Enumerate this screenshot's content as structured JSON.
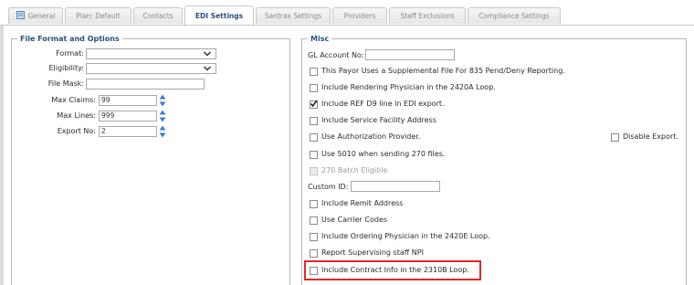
{
  "tabs": [
    {
      "label": "General",
      "icon": "document-icon"
    },
    {
      "label": "Plan: Default"
    },
    {
      "label": "Contacts"
    },
    {
      "label": "EDI Settings",
      "active": true
    },
    {
      "label": "Santrax Settings"
    },
    {
      "label": "Providers"
    },
    {
      "label": "Staff Exclusions"
    },
    {
      "label": "Compliance Settings"
    }
  ],
  "file_format": {
    "legend": "File Format and Options",
    "format_label": "Format:",
    "eligibility_label": "Eligibility:",
    "file_mask_label": "File Mask:",
    "file_mask_value": "",
    "max_claims_label": "Max Claims:",
    "max_claims_value": "99",
    "max_lines_label": "Max Lines:",
    "max_lines_value": "999",
    "export_no_label": "Export No:",
    "export_no_value": "2"
  },
  "misc": {
    "legend": "Misc",
    "gl_account_label": "GL Account No:",
    "gl_account_value": "",
    "custom_id_label": "Custom ID:",
    "custom_id_value": "",
    "checkboxes": [
      {
        "label": "This Payor Uses a Supplemental File For 835 Pend/Deny Reporting.",
        "checked": false
      },
      {
        "label": "Include Rendering Physician in the 2420A Loop.",
        "checked": false
      },
      {
        "label": "Include REF D9 line in EDI export.",
        "checked": true
      },
      {
        "label": "Include Service Facility Address",
        "checked": false
      },
      {
        "label": "Use Authorization Provider.",
        "checked": false
      },
      {
        "label": "Use 5010 when sending 270 files.",
        "checked": false
      },
      {
        "label": "270 Batch Eligible",
        "checked": false,
        "disabled": true
      },
      {
        "label": "Include Remit Address",
        "checked": false
      },
      {
        "label": "Use Carrier Codes",
        "checked": false
      },
      {
        "label": "Include Ordering Physician in the 2420E Loop.",
        "checked": false
      },
      {
        "label": "Report Supervising staff NPI",
        "checked": false
      },
      {
        "label": "Include Contract Info in the 2310B Loop.",
        "checked": false
      }
    ],
    "disable_export_label": "Disable Export.",
    "disable_export_checked": false
  },
  "colors": {
    "legend": "#2d4f7f",
    "highlight": "#e4252a",
    "spinner": "#3b7dd8"
  }
}
